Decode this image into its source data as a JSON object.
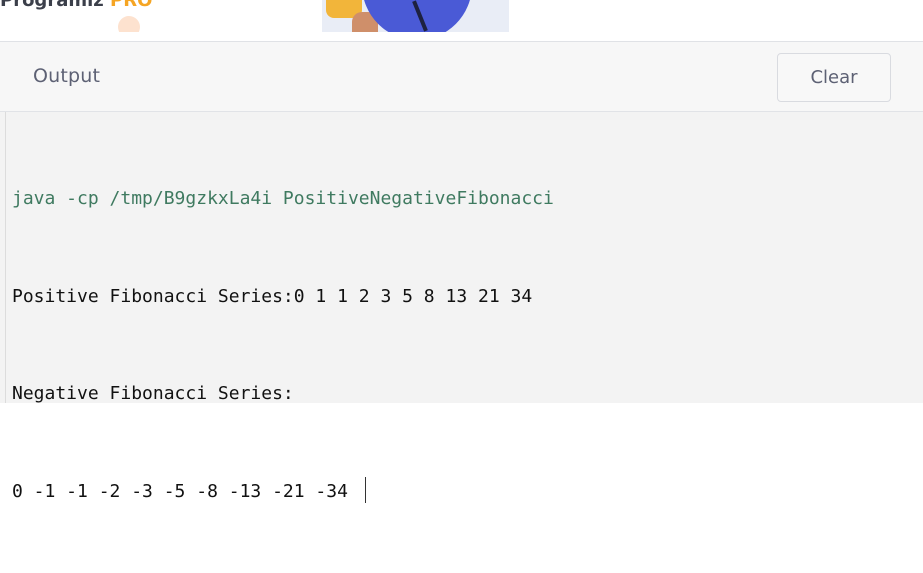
{
  "banner": {
    "text_prefix": "Programiz",
    "text_accent": " PRO"
  },
  "output": {
    "title": "Output",
    "clear_label": "Clear",
    "lines": [
      "java -cp /tmp/B9gzkxLa4i PositiveNegativeFibonacci",
      "Positive Fibonacci Series:0 1 1 2 3 5 8 13 21 34",
      "Negative Fibonacci Series:",
      "0 -1 -1 -2 -3 -5 -8 -13 -21 -34 "
    ]
  },
  "colors": {
    "command_text": "#3f7a60",
    "output_text": "#111111",
    "panel_background": "#f3f3f3",
    "header_text": "#5d6174"
  },
  "icons": {
    "cursor": "text-cursor-icon"
  }
}
